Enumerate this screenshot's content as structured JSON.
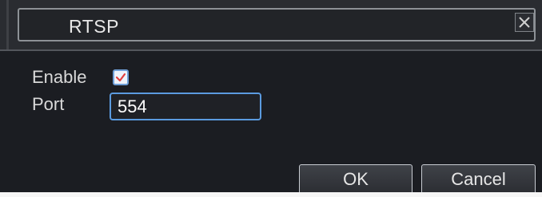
{
  "dialog": {
    "title": "RTSP",
    "close_glyph": "✕"
  },
  "form": {
    "enable_label": "Enable",
    "enable_checked": true,
    "port_label": "Port",
    "port_value": "554"
  },
  "buttons": {
    "ok_label": "OK",
    "cancel_label": "Cancel"
  },
  "colors": {
    "background": "#1b1d22",
    "accent": "#5b9be0",
    "check_mark": "#e04040"
  }
}
